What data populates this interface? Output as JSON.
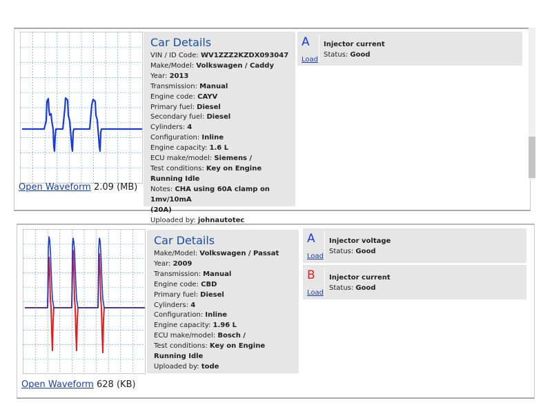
{
  "colors": {
    "accent": "#1a4fa0",
    "channel_a": "#1a3ad8",
    "channel_b": "#e02020",
    "grid": "#6fa8d0",
    "details_bg": "#e6e6e6"
  },
  "entries": [
    {
      "open_label": "Open Waveform",
      "size_value": "2.09",
      "size_unit": "(MB)",
      "details_title": "Car Details",
      "fields": [
        {
          "label": "VIN / ID Code:",
          "value": "WV1ZZZ2KZDX093047"
        },
        {
          "label": "Make/Model:",
          "value": "Volkswagen / Caddy"
        },
        {
          "label": "Year:",
          "value": "2013"
        },
        {
          "label": "Transmission:",
          "value": "Manual"
        },
        {
          "label": "Engine code:",
          "value": "CAYV"
        },
        {
          "label": "Primary fuel:",
          "value": "Diesel"
        },
        {
          "label": "Secondary fuel:",
          "value": "Diesel"
        },
        {
          "label": "Cylinders:",
          "value": "4"
        },
        {
          "label": "Configuration:",
          "value": "Inline"
        },
        {
          "label": "Engine capacity:",
          "value": "1.6 L"
        },
        {
          "label": "ECU make/model:",
          "value": "Siemens /"
        },
        {
          "label": "Test conditions:",
          "value": "Key on Engine Running Idle"
        },
        {
          "label": "Notes:",
          "value": "CHA using 60A clamp on 1mv/10mA"
        },
        {
          "label": "",
          "value": "(20A)"
        },
        {
          "label": "Uploaded by:",
          "value": "johnautotec"
        }
      ],
      "channels": [
        {
          "letter": "A",
          "load_label": "Load",
          "name": "Injector current",
          "status_label": "Status:",
          "status_value": "Good"
        }
      ]
    },
    {
      "open_label": "Open Waveform",
      "size_value": "628",
      "size_unit": "(KB)",
      "details_title": "Car Details",
      "fields": [
        {
          "label": "Make/Model:",
          "value": "Volkswagen / Passat"
        },
        {
          "label": "Year:",
          "value": "2009"
        },
        {
          "label": "Transmission:",
          "value": "Manual"
        },
        {
          "label": "Engine code:",
          "value": "CBD"
        },
        {
          "label": "Primary fuel:",
          "value": "Diesel"
        },
        {
          "label": "Cylinders:",
          "value": "4"
        },
        {
          "label": "Configuration:",
          "value": "Inline"
        },
        {
          "label": "Engine capacity:",
          "value": "1.96 L"
        },
        {
          "label": "ECU make/model:",
          "value": "Bosch /"
        },
        {
          "label": "Test conditions:",
          "value": "Key on Engine Running Idle"
        },
        {
          "label": "Uploaded by:",
          "value": "tode"
        }
      ],
      "channels": [
        {
          "letter": "A",
          "load_label": "Load",
          "name": "Injector voltage",
          "status_label": "Status:",
          "status_value": "Good"
        },
        {
          "letter": "B",
          "load_label": "Load",
          "name": "Injector current",
          "status_label": "Status:",
          "status_value": "Good"
        }
      ]
    }
  ]
}
